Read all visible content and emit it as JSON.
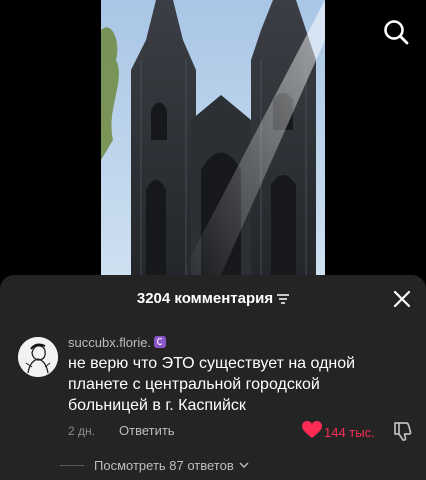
{
  "video": {
    "image_icon": "cathedral-photo"
  },
  "top_bar": {
    "search_icon": "search-icon"
  },
  "comments_sheet": {
    "title": "3204 комментария",
    "filter_icon": "filter-icon",
    "close_icon": "close-icon",
    "comments": [
      {
        "username": "succubx.florie.",
        "badge_icon": "moon-badge-icon",
        "text": "не верю что ЭТО существует на одной планете с центральной городской больницей в г. Каспийск",
        "timestamp": "2 дн.",
        "reply_label": "Ответить",
        "like_count": "144 тыс.",
        "liked": true,
        "accent_color": "#fe2c55",
        "view_replies_label": "Посмотреть 87 ответов",
        "view_replies_icon": "chevron-down-icon"
      }
    ]
  }
}
